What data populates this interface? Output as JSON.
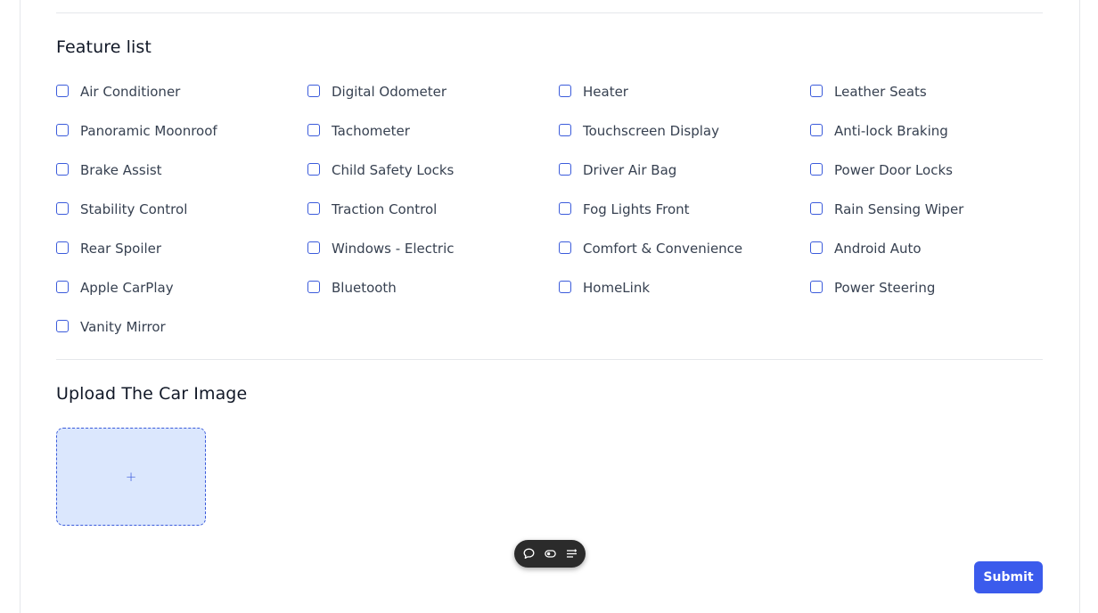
{
  "feature_section": {
    "title": "Feature list",
    "features": [
      {
        "label": "Air Conditioner",
        "checked": false
      },
      {
        "label": "Digital Odometer",
        "checked": false
      },
      {
        "label": "Heater",
        "checked": false
      },
      {
        "label": "Leather Seats",
        "checked": false
      },
      {
        "label": "Panoramic Moonroof",
        "checked": false
      },
      {
        "label": "Tachometer",
        "checked": false
      },
      {
        "label": "Touchscreen Display",
        "checked": false
      },
      {
        "label": "Anti-lock Braking",
        "checked": false
      },
      {
        "label": "Brake Assist",
        "checked": false
      },
      {
        "label": "Child Safety Locks",
        "checked": false
      },
      {
        "label": "Driver Air Bag",
        "checked": false
      },
      {
        "label": "Power Door Locks",
        "checked": false
      },
      {
        "label": "Stability Control",
        "checked": false
      },
      {
        "label": "Traction Control",
        "checked": false
      },
      {
        "label": "Fog Lights Front",
        "checked": false
      },
      {
        "label": "Rain Sensing Wiper",
        "checked": false
      },
      {
        "label": "Rear Spoiler",
        "checked": false
      },
      {
        "label": "Windows - Electric",
        "checked": false
      },
      {
        "label": "Comfort & Convenience",
        "checked": false
      },
      {
        "label": "Android Auto",
        "checked": false
      },
      {
        "label": "Apple CarPlay",
        "checked": false
      },
      {
        "label": "Bluetooth",
        "checked": false
      },
      {
        "label": "HomeLink",
        "checked": false
      },
      {
        "label": "Power Steering",
        "checked": false
      },
      {
        "label": "Vanity Mirror",
        "checked": false
      }
    ]
  },
  "upload_section": {
    "title": "Upload The Car Image",
    "plus_symbol": "+"
  },
  "floating_toolbar": {
    "icons": [
      "comment-icon",
      "toggle-icon",
      "menu-lines-icon"
    ]
  },
  "actions": {
    "submit_label": "Submit"
  },
  "colors": {
    "accent": "#3b5bec",
    "checkbox_border": "#3b5bdb",
    "upload_bg": "#dbe7fd",
    "toolbar_bg": "#2b2b2b",
    "divider": "#e5e7eb"
  }
}
